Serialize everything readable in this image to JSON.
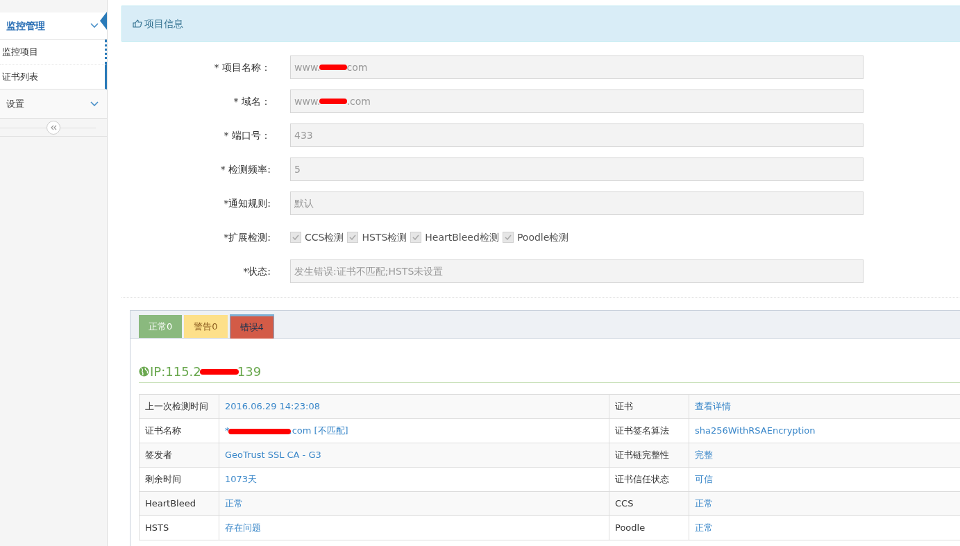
{
  "sidebar": {
    "groups": [
      {
        "label": "监控管理",
        "expanded": true,
        "items": [
          {
            "label": "监控项目"
          },
          {
            "label": "证书列表"
          }
        ]
      },
      {
        "label": "设置",
        "expanded": false
      }
    ]
  },
  "panel": {
    "title": "项目信息"
  },
  "form": {
    "fields": [
      {
        "kind": "text",
        "label": "* 项目名称：",
        "value_start": "www.",
        "value_end": "com",
        "redacted": true
      },
      {
        "kind": "text",
        "label": "* 域名：",
        "value_start": "www.",
        "value_end": ".com",
        "redacted": true
      },
      {
        "kind": "text",
        "label": "* 端口号：",
        "value_start": "433"
      },
      {
        "kind": "text",
        "label": "* 检测频率:",
        "value_start": "5"
      },
      {
        "kind": "text",
        "label": "*通知规则:",
        "value_start": "默认"
      },
      {
        "kind": "checks",
        "label": "*扩展检测:",
        "options": [
          {
            "label": "CCS检测",
            "checked": true
          },
          {
            "label": "HSTS检测",
            "checked": true
          },
          {
            "label": "HeartBleed检测",
            "checked": true
          },
          {
            "label": "Poodle检测",
            "checked": true
          }
        ]
      },
      {
        "kind": "text",
        "label": "*状态:",
        "value_start": "发生错误:证书不匹配;HSTS未设置"
      }
    ]
  },
  "result_tabs": [
    {
      "label": "正常0",
      "color": "#8ab97e",
      "selected": false
    },
    {
      "label": "警告0",
      "color": "#fde08a",
      "selected": false
    },
    {
      "label": "错误4",
      "color": "#d35b47",
      "selected": true
    }
  ],
  "ip": {
    "start": "IP:115.2",
    "end": "139",
    "redacted": true
  },
  "table": {
    "rows": [
      {
        "label_1": "上一次检测时间",
        "value_1": "2016.06.29 14:23:08",
        "label_2": "证书",
        "value_2": "查看详情"
      },
      {
        "label_1": "证书名称",
        "value_1": "*",
        "value_1_end": ".com [不匹配]",
        "redacted": true,
        "label_2": "证书签名算法",
        "value_2": "sha256WithRSAEncryption"
      },
      {
        "label_1": "签发者",
        "value_1": "GeoTrust SSL CA - G3",
        "label_2": "证书链完整性",
        "value_2": "完整"
      },
      {
        "label_1": "剩余时间",
        "value_1": "1073天",
        "label_2": "证书信任状态",
        "value_2": "可信"
      },
      {
        "label_1": "HeartBleed",
        "value_1": "正常",
        "label_2": "CCS",
        "value_2": "正常"
      },
      {
        "label_1": "HSTS",
        "value_1": "存在问题",
        "label_2": "Poodle",
        "value_2": "正常"
      }
    ]
  }
}
